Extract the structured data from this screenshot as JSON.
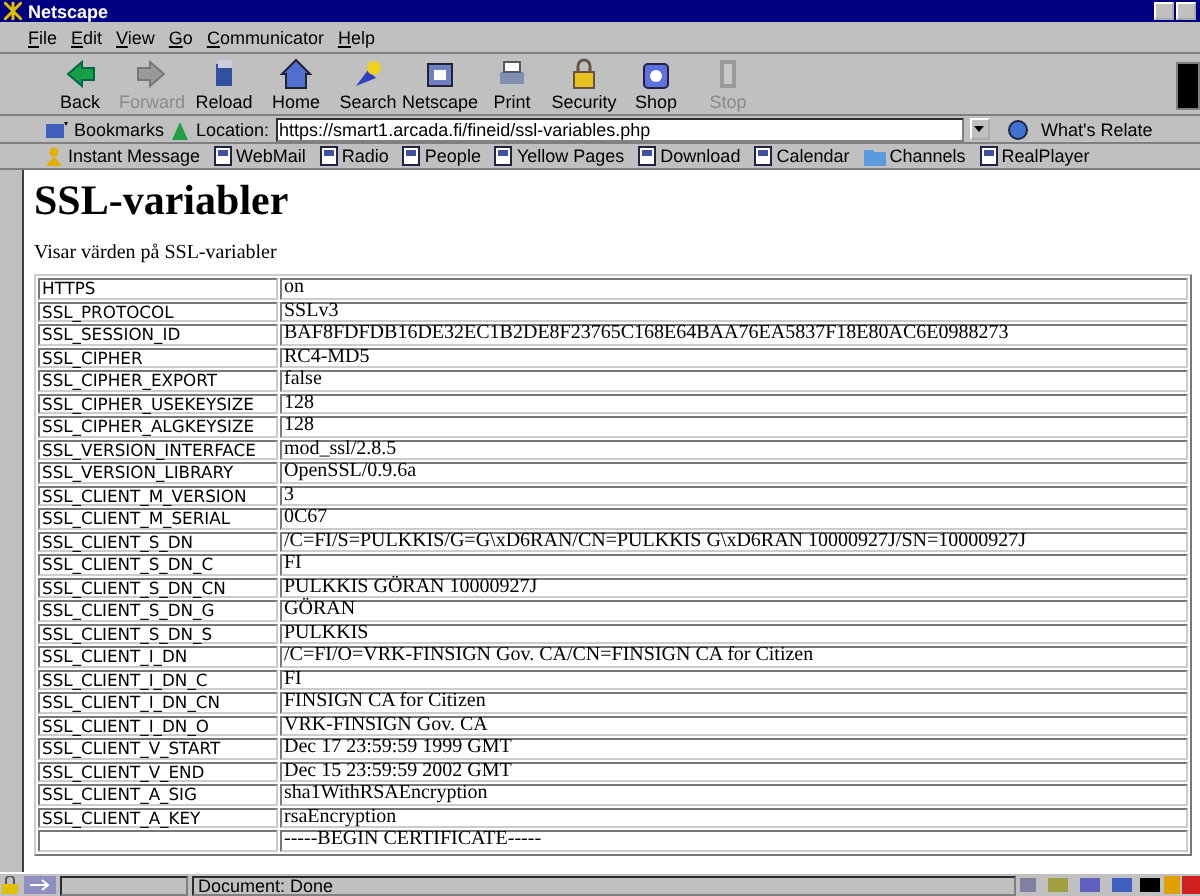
{
  "window": {
    "title": "Netscape"
  },
  "menu": [
    "File",
    "Edit",
    "View",
    "Go",
    "Communicator",
    "Help"
  ],
  "toolbar": [
    {
      "label": "Back",
      "disabled": false
    },
    {
      "label": "Forward",
      "disabled": true
    },
    {
      "label": "Reload",
      "disabled": false
    },
    {
      "label": "Home",
      "disabled": false
    },
    {
      "label": "Search",
      "disabled": false
    },
    {
      "label": "Netscape",
      "disabled": false
    },
    {
      "label": "Print",
      "disabled": false
    },
    {
      "label": "Security",
      "disabled": false
    },
    {
      "label": "Shop",
      "disabled": false
    },
    {
      "label": "Stop",
      "disabled": true
    }
  ],
  "location": {
    "bookmarks": "Bookmarks",
    "label": "Location:",
    "value": "https://smart1.arcada.fi/fineid/ssl-variables.php",
    "related": "What's Relate"
  },
  "personal_toolbar": [
    "Instant Message",
    "WebMail",
    "Radio",
    "People",
    "Yellow Pages",
    "Download",
    "Calendar",
    "Channels",
    "RealPlayer"
  ],
  "page": {
    "heading": "SSL-variabler",
    "intro": "Visar värden på SSL-variabler",
    "rows": [
      {
        "name": "HTTPS",
        "value": "on"
      },
      {
        "name": "SSL_PROTOCOL",
        "value": "SSLv3"
      },
      {
        "name": "SSL_SESSION_ID",
        "value": "BAF8FDFDB16DE32EC1B2DE8F23765C168E64BAA76EA5837F18E80AC6E0988273"
      },
      {
        "name": "SSL_CIPHER",
        "value": "RC4-MD5"
      },
      {
        "name": "SSL_CIPHER_EXPORT",
        "value": "false"
      },
      {
        "name": "SSL_CIPHER_USEKEYSIZE",
        "value": "128"
      },
      {
        "name": "SSL_CIPHER_ALGKEYSIZE",
        "value": "128"
      },
      {
        "name": "SSL_VERSION_INTERFACE",
        "value": "mod_ssl/2.8.5"
      },
      {
        "name": "SSL_VERSION_LIBRARY",
        "value": "OpenSSL/0.9.6a"
      },
      {
        "name": "SSL_CLIENT_M_VERSION",
        "value": "3"
      },
      {
        "name": "SSL_CLIENT_M_SERIAL",
        "value": "0C67"
      },
      {
        "name": "SSL_CLIENT_S_DN",
        "value": "/C=FI/S=PULKKIS/G=G\\xD6RAN/CN=PULKKIS G\\xD6RAN 10000927J/SN=10000927J"
      },
      {
        "name": "SSL_CLIENT_S_DN_C",
        "value": "FI"
      },
      {
        "name": "SSL_CLIENT_S_DN_CN",
        "value": "PULKKIS GÖRAN 10000927J"
      },
      {
        "name": "SSL_CLIENT_S_DN_G",
        "value": "GÖRAN"
      },
      {
        "name": "SSL_CLIENT_S_DN_S",
        "value": "PULKKIS"
      },
      {
        "name": "SSL_CLIENT_I_DN",
        "value": "/C=FI/O=VRK-FINSIGN Gov. CA/CN=FINSIGN CA for Citizen"
      },
      {
        "name": "SSL_CLIENT_I_DN_C",
        "value": "FI"
      },
      {
        "name": "SSL_CLIENT_I_DN_CN",
        "value": "FINSIGN CA for Citizen"
      },
      {
        "name": "SSL_CLIENT_I_DN_O",
        "value": "VRK-FINSIGN Gov. CA"
      },
      {
        "name": "SSL_CLIENT_V_START",
        "value": "Dec 17 23:59:59 1999 GMT"
      },
      {
        "name": "SSL_CLIENT_V_END",
        "value": "Dec 15 23:59:59 2002 GMT"
      },
      {
        "name": "SSL_CLIENT_A_SIG",
        "value": "sha1WithRSAEncryption"
      },
      {
        "name": "SSL_CLIENT_A_KEY",
        "value": "rsaEncryption"
      },
      {
        "value": "-----BEGIN CERTIFICATE-----"
      }
    ]
  },
  "status_bar": {
    "text": "Document: Done"
  }
}
